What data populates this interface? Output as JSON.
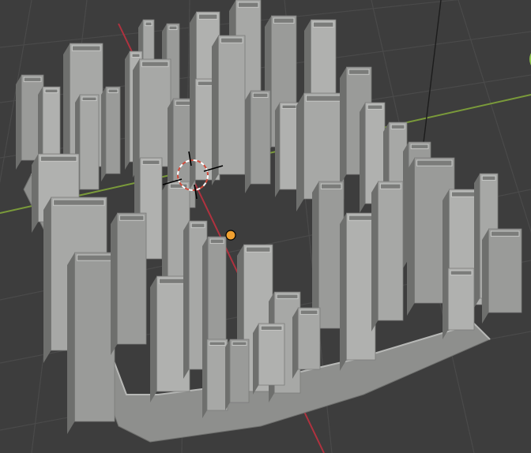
{
  "app": {
    "name": "3D viewport"
  },
  "viewport": {
    "background_color": "#3d3d3d",
    "grid_color": "#4a4a4a",
    "x_axis_color": "#b0323f",
    "y_axis_color": "#7a9a3a",
    "model_color": "#a0a19f"
  },
  "cursor_3d": {
    "icon": "3d-cursor-icon",
    "ring_colors": [
      "#d04b3c",
      "#ffffff"
    ]
  },
  "object_origin": {
    "icon": "origin-dot-icon",
    "color": "#f0a030"
  },
  "gizmo_hint": {
    "icon": "navigation-gizmo-icon",
    "color": "#8cc14a"
  }
}
